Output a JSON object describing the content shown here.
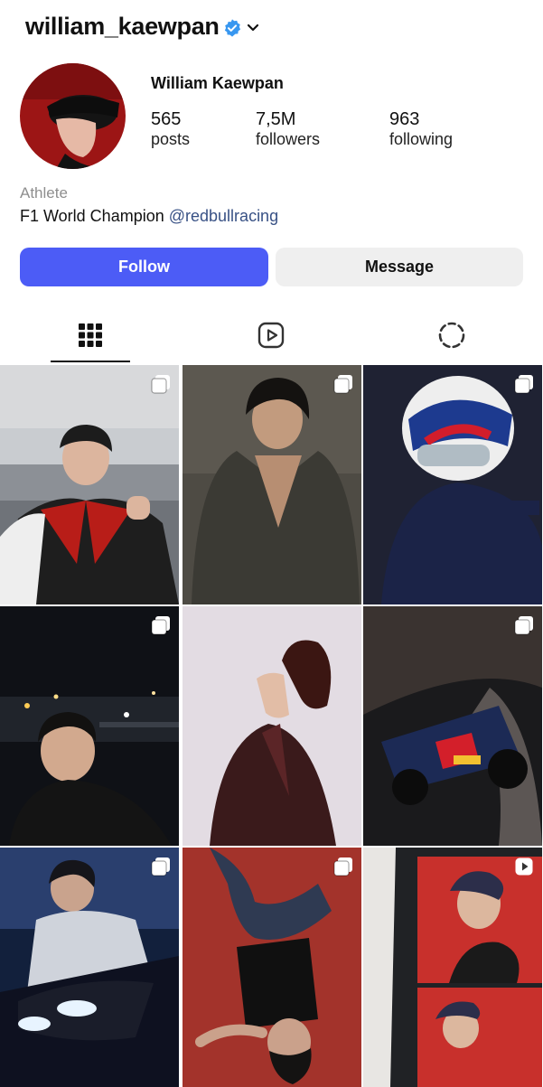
{
  "profile": {
    "username": "william_kaewpan",
    "full_name": "William Kaewpan",
    "category": "Athlete",
    "bio_text": "F1 World Champion",
    "bio_mention": "@redbullracing"
  },
  "stats": [
    {
      "value": "565",
      "label": "posts"
    },
    {
      "value": "7,5M",
      "label": "followers"
    },
    {
      "value": "963",
      "label": "following"
    }
  ],
  "actions": {
    "follow": "Follow",
    "message": "Message"
  },
  "tabs": [
    {
      "name": "posts-grid",
      "icon": "grid-icon",
      "active": true
    },
    {
      "name": "reels",
      "icon": "reels-play-icon",
      "active": false
    },
    {
      "name": "tagged",
      "icon": "dashed-circle-icon",
      "active": false
    }
  ],
  "colors": {
    "accent": "#4c5cf6",
    "verified": "#3897f0",
    "mention": "#385185"
  },
  "posts": [
    {
      "overlay": "multi-photo-icon"
    },
    {
      "overlay": "multi-photo-icon"
    },
    {
      "overlay": "multi-photo-icon"
    },
    {
      "overlay": "multi-photo-icon"
    },
    {
      "overlay": "none"
    },
    {
      "overlay": "multi-photo-icon"
    },
    {
      "overlay": "multi-photo-icon"
    },
    {
      "overlay": "multi-photo-icon"
    },
    {
      "overlay": "reel-icon"
    }
  ]
}
